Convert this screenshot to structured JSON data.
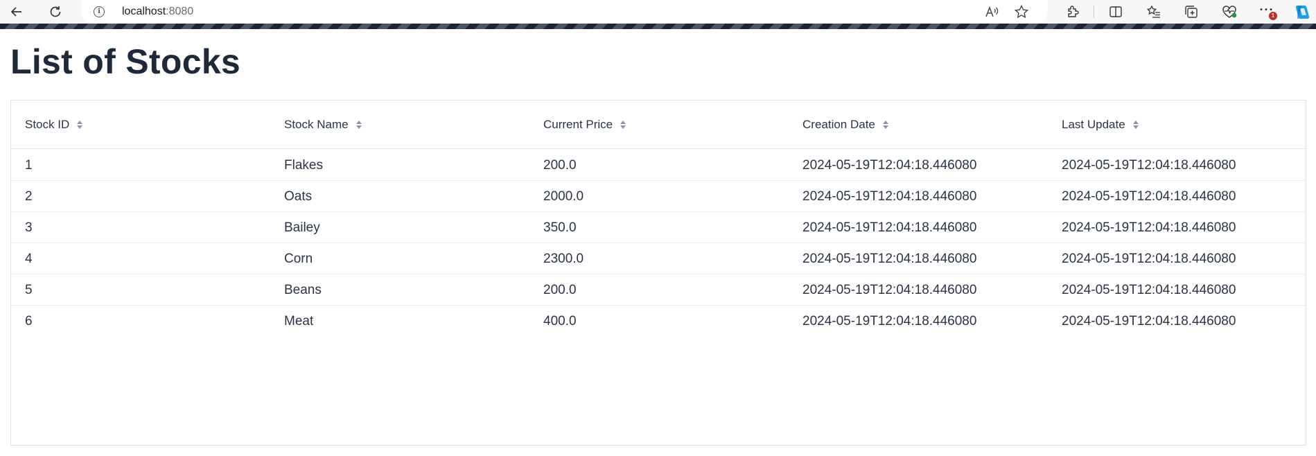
{
  "browser": {
    "url_host": "localhost",
    "url_port": ":8080",
    "notification_count": "1"
  },
  "page": {
    "title": "List of Stocks"
  },
  "grid": {
    "columns": [
      "Stock ID",
      "Stock Name",
      "Current Price",
      "Creation Date",
      "Last Update"
    ],
    "rows": [
      [
        "1",
        "Flakes",
        "200.0",
        "2024-05-19T12:04:18.446080",
        "2024-05-19T12:04:18.446080"
      ],
      [
        "2",
        "Oats",
        "2000.0",
        "2024-05-19T12:04:18.446080",
        "2024-05-19T12:04:18.446080"
      ],
      [
        "3",
        "Bailey",
        "350.0",
        "2024-05-19T12:04:18.446080",
        "2024-05-19T12:04:18.446080"
      ],
      [
        "4",
        "Corn",
        "2300.0",
        "2024-05-19T12:04:18.446080",
        "2024-05-19T12:04:18.446080"
      ],
      [
        "5",
        "Beans",
        "200.0",
        "2024-05-19T12:04:18.446080",
        "2024-05-19T12:04:18.446080"
      ],
      [
        "6",
        "Meat",
        "400.0",
        "2024-05-19T12:04:18.446080",
        "2024-05-19T12:04:18.446080"
      ]
    ]
  },
  "colors": {
    "title": "#1e2939",
    "text": "#2a3444",
    "stripe_dark": "#1d2533",
    "badge": "#c42b1c"
  }
}
